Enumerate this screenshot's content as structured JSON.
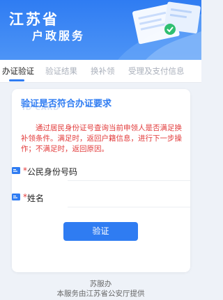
{
  "banner": {
    "title_line1": "江苏省",
    "title_line2": "户政服务"
  },
  "tabs": [
    {
      "label": "办证验证",
      "active": true
    },
    {
      "label": "验证结果",
      "active": false
    },
    {
      "label": "换补领",
      "active": false
    },
    {
      "label": "受理及支付信息",
      "active": false
    }
  ],
  "card": {
    "title": "验证是否符合办证要求",
    "watermark": "ID CARD",
    "notice": "通过居民身份证号查询当前申领人是否满足换补领条件。满足时，返回户籍信息，进行下一步操作；不满足时，返回原因。",
    "fields": [
      {
        "label": "公民身份号码",
        "required_mark": "*",
        "value": ""
      },
      {
        "label": "姓名",
        "required_mark": "*",
        "value": ""
      }
    ],
    "submit_label": "验证"
  },
  "footer": {
    "line1": "苏服办",
    "line2": "本服务由江苏省公安厅提供"
  },
  "colors": {
    "accent": "#2f7cf2",
    "notice": "#e23b3b",
    "background": "#eef2f8"
  }
}
